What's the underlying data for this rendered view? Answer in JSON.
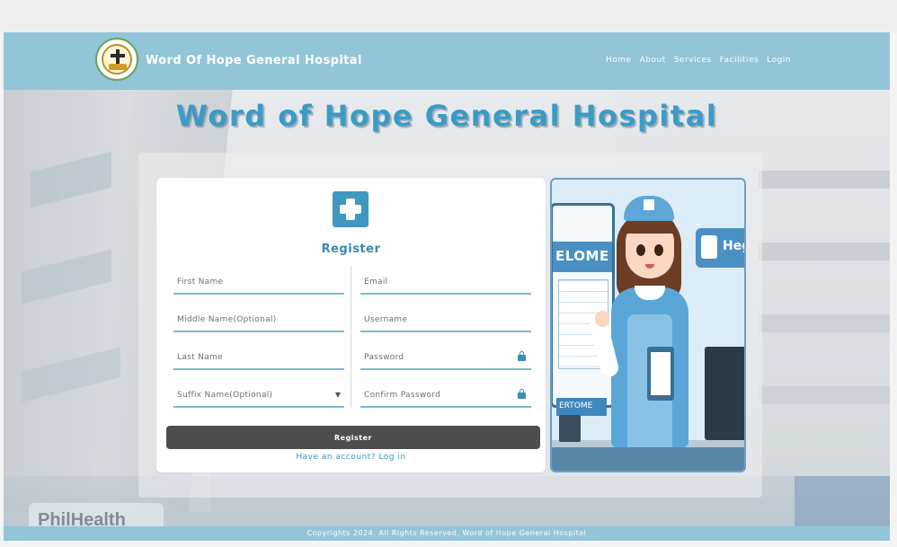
{
  "header": {
    "site_title": "Word Of Hope General Hospital",
    "nav": [
      "Home",
      "About",
      "Services",
      "Facilities",
      "Login"
    ]
  },
  "hero": {
    "title": "Word of Hope General Hospital"
  },
  "background": {
    "sign_text": "PhilHealth"
  },
  "form": {
    "title": "Register",
    "fields": {
      "first_name": {
        "placeholder": "First Name",
        "value": ""
      },
      "middle_name": {
        "placeholder": "Middle Name(Optional)",
        "value": ""
      },
      "last_name": {
        "placeholder": "Last Name",
        "value": ""
      },
      "suffix_name": {
        "placeholder": "Suffix Name(Optional)",
        "value": ""
      },
      "email": {
        "placeholder": "Email",
        "value": ""
      },
      "username": {
        "placeholder": "Username",
        "value": ""
      },
      "password": {
        "placeholder": "Password",
        "value": ""
      },
      "confirm_password": {
        "placeholder": "Confirm Password",
        "value": ""
      }
    },
    "register_button": "Register",
    "login_link": "Have an account? Log in"
  },
  "illustration": {
    "board_text": "ELOME",
    "board_label": "ERTOME",
    "sign_text": "Hegi"
  },
  "footer": {
    "text": "Copyrights 2024. All Rights Reserved. Word of Hope General Hospital"
  },
  "colors": {
    "header_bg": "#92c5d8",
    "accent": "#3b9bc5",
    "button_bg": "#4e4e4e",
    "field_underline": "#7fb8cf"
  },
  "icons": [
    "hospital-logo-icon",
    "medical-cross-icon",
    "lock-icon",
    "chevron-down-icon"
  ]
}
